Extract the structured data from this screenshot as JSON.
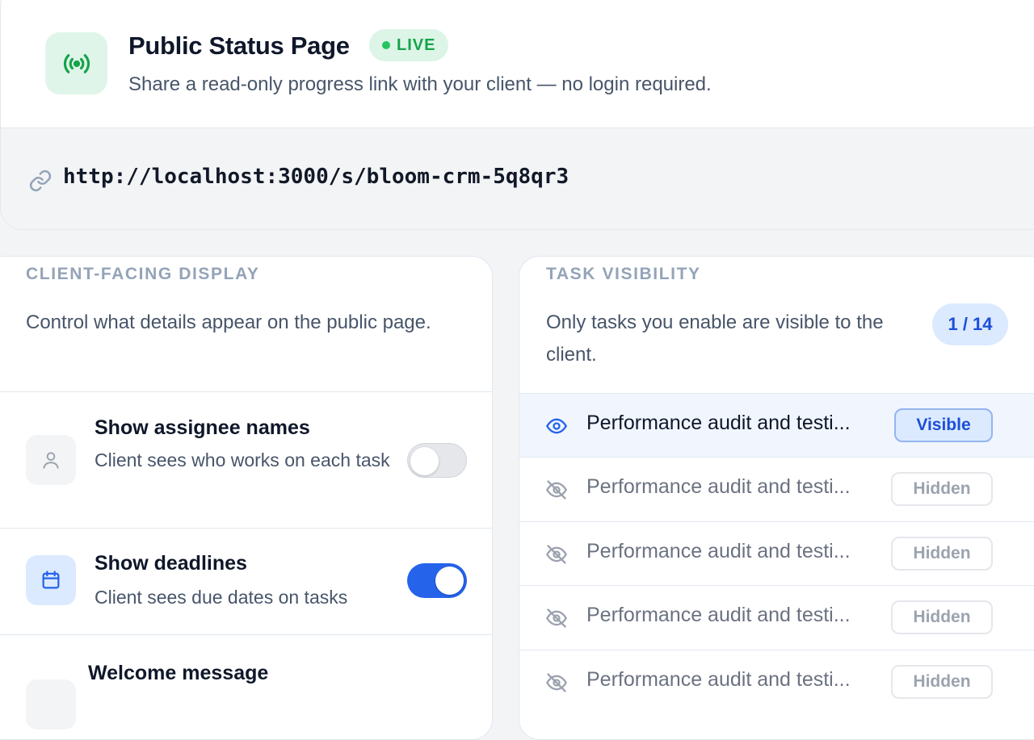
{
  "header": {
    "title": "Public Status Page",
    "live_label": "LIVE",
    "subtitle": "Share a read-only progress link with your client — no login required.",
    "url": "http://localhost:3000/s/bloom-crm-5q8qr3"
  },
  "display": {
    "kicker": "CLIENT-FACING DISPLAY",
    "description": "Control what details appear on the public page.",
    "rows": [
      {
        "title": "Show assignee names",
        "description": "Client sees who works on each task",
        "enabled": false
      },
      {
        "title": "Show deadlines",
        "description": "Client sees due dates on tasks",
        "enabled": true
      },
      {
        "title": "Welcome message",
        "description": ""
      }
    ]
  },
  "visibility": {
    "kicker": "TASK VISIBILITY",
    "description": "Only tasks you enable are visible to the client.",
    "count": "1 / 14",
    "tasks": [
      {
        "name": "Performance audit and testi...",
        "status": "Visible"
      },
      {
        "name": "Performance audit and testi...",
        "status": "Hidden"
      },
      {
        "name": "Performance audit and testi...",
        "status": "Hidden"
      },
      {
        "name": "Performance audit and testi...",
        "status": "Hidden"
      },
      {
        "name": "Performance audit and testi...",
        "status": "Hidden"
      }
    ]
  },
  "colors": {
    "accent_green": "#22c55e",
    "accent_blue": "#2563eb",
    "muted": "#94a3b8"
  },
  "icons": {
    "app": "broadcast-icon",
    "url": "link-icon",
    "assignee": "user-icon",
    "deadlines": "calendar-icon",
    "visible": "eye-icon",
    "hidden": "eye-off-icon"
  }
}
